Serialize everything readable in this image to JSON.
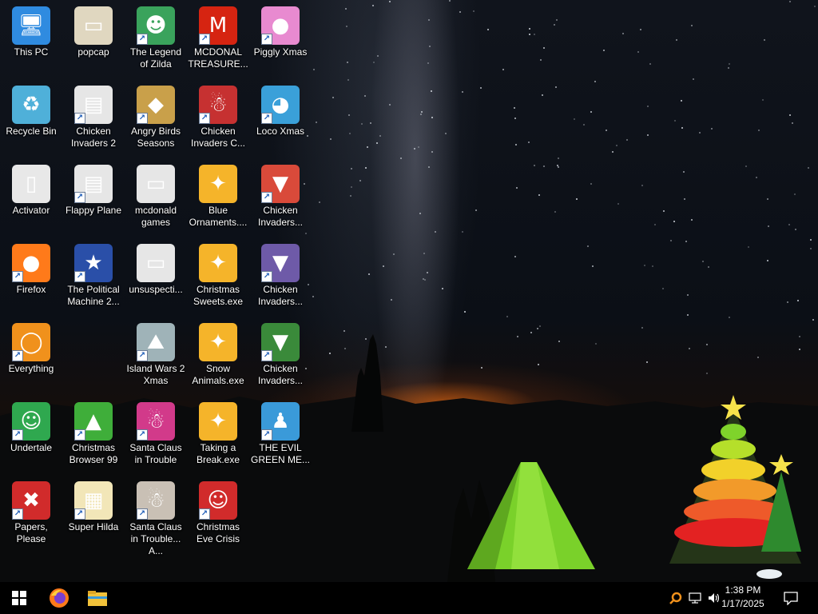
{
  "desktop": {
    "icons": [
      {
        "label": "This PC",
        "icon": "computer-icon",
        "color": "#2f8be0",
        "shortcut": false
      },
      {
        "label": "Recycle Bin",
        "icon": "recycle-bin-icon",
        "color": "#4fb0d9",
        "shortcut": false
      },
      {
        "label": "Activator",
        "icon": "file-icon",
        "color": "#e8e8e8",
        "shortcut": false
      },
      {
        "label": "Firefox",
        "icon": "firefox-icon",
        "color": "#ff7a1a",
        "shortcut": true
      },
      {
        "label": "Everything",
        "icon": "everything-search-icon",
        "color": "#f0911c",
        "shortcut": true
      },
      {
        "label": "Undertale",
        "icon": "undertale-icon",
        "color": "#2fa84f",
        "shortcut": true
      },
      {
        "label": "Papers, Please",
        "icon": "papers-please-icon",
        "color": "#d12b2b",
        "shortcut": true
      },
      {
        "label": "popcap",
        "icon": "folder-icon",
        "color": "#e0d7c0",
        "shortcut": false
      },
      {
        "label": "Chicken Invaders 2",
        "icon": "document-icon",
        "color": "#e6e6e6",
        "shortcut": true
      },
      {
        "label": "Flappy Plane",
        "icon": "document-icon",
        "color": "#e6e6e6",
        "shortcut": true
      },
      {
        "label": "The Political Machine 2...",
        "icon": "political-machine-icon",
        "color": "#2a4fa8",
        "shortcut": true
      },
      {
        "label": "Christmas Browser 99",
        "icon": "christmas-tree-icon",
        "color": "#3fae3a",
        "shortcut": true
      },
      {
        "label": "Super Hilda",
        "icon": "super-hilda-icon",
        "color": "#f2e6b8",
        "shortcut": true
      },
      {
        "label": "The Legend of Zilda",
        "icon": "legend-zilda-icon",
        "color": "#3aa35c",
        "shortcut": true
      },
      {
        "label": "Angry Birds Seasons",
        "icon": "angry-birds-icon",
        "color": "#c9a04a",
        "shortcut": true
      },
      {
        "label": "mcdonald games",
        "icon": "folder-icon",
        "color": "#e6e6e6",
        "shortcut": false
      },
      {
        "label": "unsuspecti...",
        "icon": "folder-icon",
        "color": "#e6e6e6",
        "shortcut": false
      },
      {
        "label": "Island Wars 2 Xmas",
        "icon": "island-wars-icon",
        "color": "#9fb3b8",
        "shortcut": true
      },
      {
        "label": "Santa Claus in Trouble",
        "icon": "santa-claus-icon",
        "color": "#d23a8a",
        "shortcut": true
      },
      {
        "label": "Santa Claus in Trouble... A...",
        "icon": "santa-claus-icon",
        "color": "#c9c0b5",
        "shortcut": true
      },
      {
        "label": "MCDONAL TREASURE...",
        "icon": "mcdonalds-icon",
        "color": "#d62411",
        "shortcut": true
      },
      {
        "label": "Chicken Invaders C...",
        "icon": "snowman-icon",
        "color": "#c63131",
        "shortcut": true
      },
      {
        "label": "Blue Ornaments....",
        "icon": "ornament-exe-icon",
        "color": "#f5b42a",
        "shortcut": false
      },
      {
        "label": "Christmas Sweets.exe",
        "icon": "ornament-exe-icon",
        "color": "#f5b42a",
        "shortcut": false
      },
      {
        "label": "Snow Animals.exe",
        "icon": "ornament-exe-icon",
        "color": "#f5b42a",
        "shortcut": false
      },
      {
        "label": "Taking a Break.exe",
        "icon": "ornament-exe-icon",
        "color": "#f5b42a",
        "shortcut": false
      },
      {
        "label": "Christmas Eve Crisis",
        "icon": "santa-face-icon",
        "color": "#d12b2b",
        "shortcut": true
      },
      {
        "label": "Piggly Xmas",
        "icon": "piggly-icon",
        "color": "#e88ad0",
        "shortcut": true
      },
      {
        "label": "Loco Xmas",
        "icon": "teddy-bear-icon",
        "color": "#3aa0d9",
        "shortcut": true
      },
      {
        "label": "Chicken Invaders...",
        "icon": "chicken-invaders-icon",
        "color": "#d94a3a",
        "shortcut": true
      },
      {
        "label": "Chicken Invaders...",
        "icon": "chicken-invaders-icon",
        "color": "#6e5aa8",
        "shortcut": true
      },
      {
        "label": "Chicken Invaders...",
        "icon": "chicken-invaders-icon",
        "color": "#3a8a3a",
        "shortcut": true
      },
      {
        "label": "THE EVIL GREEN ME...",
        "icon": "messenger-icon",
        "color": "#3a9ad9",
        "shortcut": true
      }
    ]
  },
  "taskbar": {
    "start_icon": "windows-start-icon",
    "pinned": [
      {
        "name": "firefox-taskbar-icon",
        "color": "#ff7a1a"
      },
      {
        "name": "file-explorer-icon",
        "color": "#f2c23a"
      }
    ],
    "tray": {
      "search_icon": "everything-tray-icon",
      "network_icon": "network-icon",
      "volume_icon": "volume-icon",
      "time": "1:38 PM",
      "date": "1/17/2025",
      "notification_icon": "action-center-icon"
    }
  }
}
